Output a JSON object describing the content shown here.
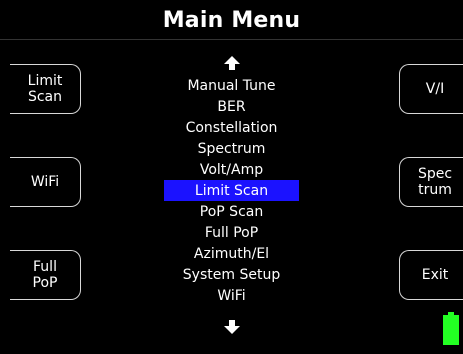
{
  "title": "Main Menu",
  "left_buttons": [
    "Limit\nScan",
    "WiFi",
    "Full\nPoP"
  ],
  "right_buttons": [
    "V/I",
    "Spec\ntrum",
    "Exit"
  ],
  "menu_items": [
    "Manual Tune",
    "BER",
    "Constellation",
    "Spectrum",
    "Volt/Amp",
    "Limit Scan",
    "PoP Scan",
    "Full PoP",
    "Azimuth/El",
    "System Setup",
    "WiFi"
  ],
  "selected_item": "Limit Scan",
  "icons": {
    "scroll_up": "arrow-up-icon",
    "scroll_down": "arrow-down-icon",
    "battery": "battery-icon"
  },
  "colors": {
    "selection": "#1b12ff",
    "battery": "#23ff23",
    "button_border": "#d8d8d8"
  }
}
